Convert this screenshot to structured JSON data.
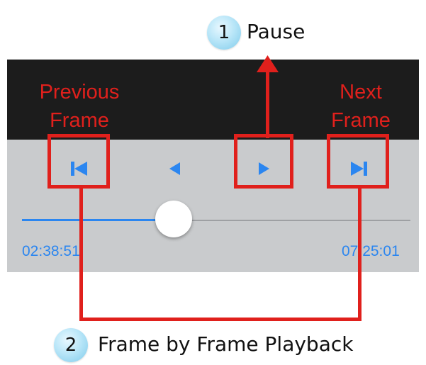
{
  "callouts": [
    {
      "number": "1",
      "label": "Pause"
    },
    {
      "number": "2",
      "label": "Frame by Frame Playback"
    }
  ],
  "labels": {
    "previous_frame": "Previous\nFrame",
    "next_frame": "Next\nFrame"
  },
  "player": {
    "current_time": "02:38:51",
    "total_time": "07:25:01",
    "progress": 0.39
  },
  "controls": [
    {
      "name": "previous-frame",
      "icon": "skip-back-icon"
    },
    {
      "name": "play-reverse",
      "icon": "triangle-left-icon"
    },
    {
      "name": "play",
      "icon": "triangle-right-icon"
    },
    {
      "name": "next-frame",
      "icon": "skip-forward-icon"
    }
  ],
  "colors": {
    "annotation_red": "#e0201c",
    "accent_blue": "#2b86f0",
    "topbar": "#1c1c1c",
    "panel": "#c9cbcd"
  }
}
